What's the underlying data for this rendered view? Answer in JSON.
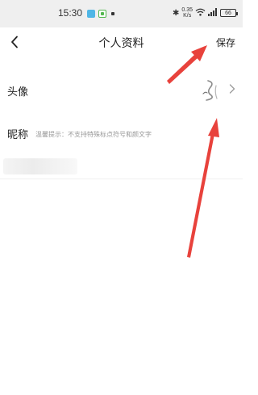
{
  "status_bar": {
    "time": "15:30",
    "network_speed_value": "0.35",
    "network_speed_unit": "K/s",
    "battery_level": "66",
    "icons": [
      "app-icon",
      "app-icon",
      "bluetooth-icon",
      "sim-icon",
      "wifi-icon",
      "signal-icon",
      "battery-icon"
    ]
  },
  "header": {
    "title": "个人资料",
    "save_label": "保存",
    "back_icon": "chevron-left-icon"
  },
  "profile": {
    "avatar_label": "头像",
    "nickname_label": "昵称",
    "nickname_value": "",
    "nickname_placeholder": "温馨提示：不支持特殊标点符号和颜文字"
  },
  "annotation_color": "#e8423c"
}
